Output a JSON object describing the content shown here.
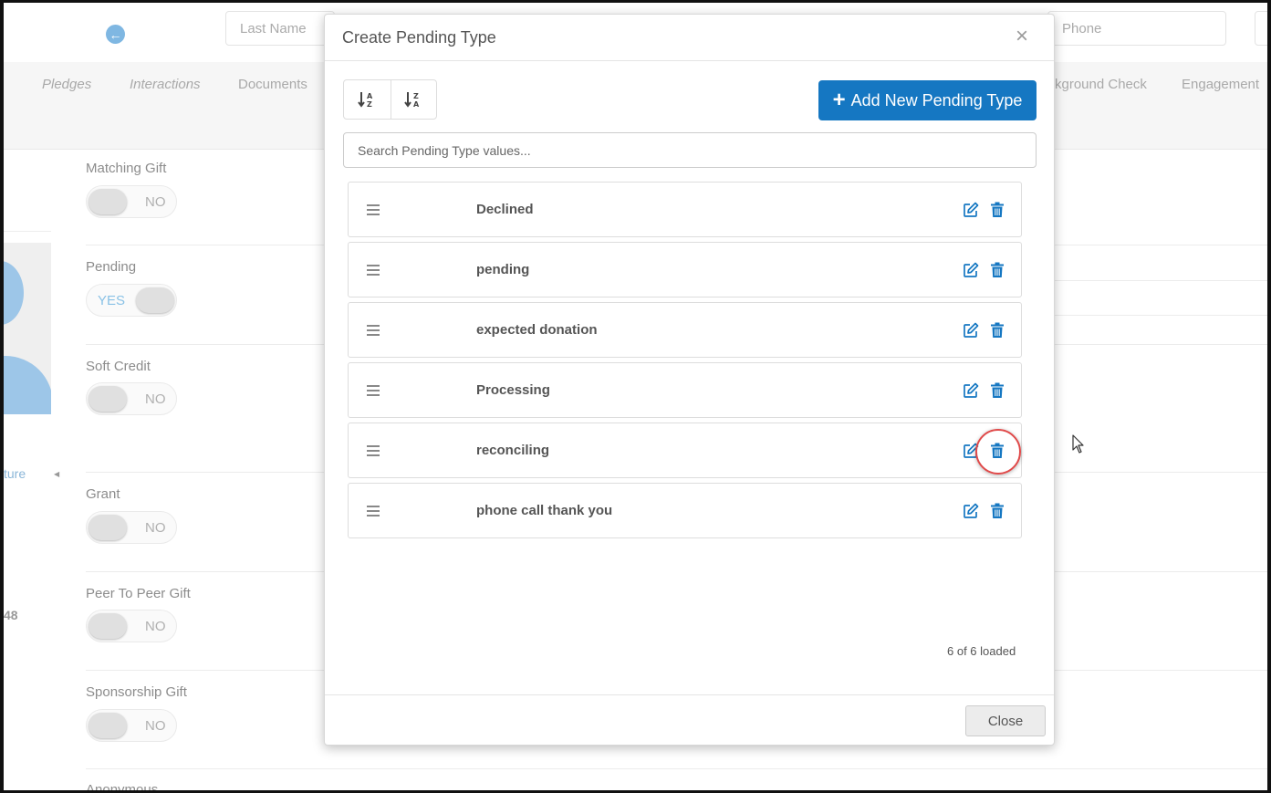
{
  "header": {
    "search_fields": [
      {
        "placeholder": "Last Name"
      },
      {
        "placeholder": "Phone"
      }
    ]
  },
  "nav": {
    "items": [
      {
        "label": "Pledges"
      },
      {
        "label": "Interactions"
      },
      {
        "label": "Documents"
      },
      {
        "label": "kground Check"
      },
      {
        "label": "Engagement"
      }
    ]
  },
  "sidebar": {
    "link_text": "ture",
    "number_text": "48"
  },
  "form": {
    "fields": [
      {
        "label": "Matching Gift",
        "toggle_text": "NO"
      },
      {
        "label": "Pending",
        "toggle_text": "YES"
      },
      {
        "label": "Soft Credit",
        "toggle_text": "NO"
      },
      {
        "label": "Grant",
        "toggle_text": "NO"
      },
      {
        "label": "Peer To Peer Gift",
        "toggle_text": "NO"
      },
      {
        "label": "Sponsorship Gift",
        "toggle_text": "NO"
      },
      {
        "label": "Anonymous"
      }
    ]
  },
  "modal": {
    "title": "Create Pending Type",
    "close_icon": "×",
    "add_button_label": "Add New Pending Type",
    "add_button_icon": "+",
    "search_placeholder": "Search Pending Type values...",
    "items": [
      {
        "label": "Declined"
      },
      {
        "label": "pending"
      },
      {
        "label": "expected donation"
      },
      {
        "label": "Processing"
      },
      {
        "label": "reconciling"
      },
      {
        "label": "phone call thank you"
      }
    ],
    "highlighted_item_index": 4,
    "loaded_text": "6 of 6 loaded",
    "close_button_label": "Close"
  },
  "colors": {
    "primary": "#1577c2",
    "highlight_ring": "#e04a4a",
    "toggle_on_text": "#8ac2e6"
  }
}
